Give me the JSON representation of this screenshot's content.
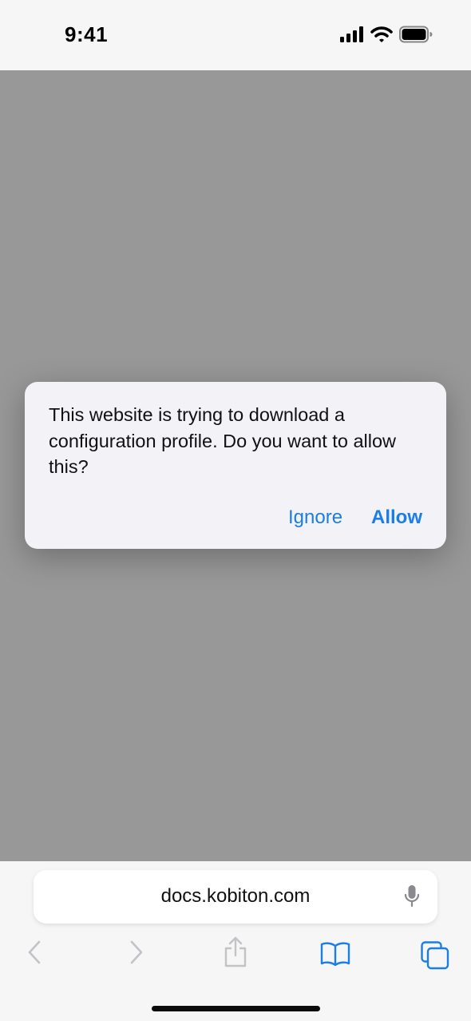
{
  "status_bar": {
    "time": "9:41",
    "icons": [
      "cellular-signal-icon",
      "wifi-icon",
      "battery-icon"
    ]
  },
  "alert": {
    "message": "This website is trying to download a configuration profile. Do you want to allow this?",
    "ignore_label": "Ignore",
    "allow_label": "Allow"
  },
  "toolbar": {
    "address": "docs.kobiton.com",
    "buttons": [
      "back-icon",
      "forward-icon",
      "share-icon",
      "bookmarks-icon",
      "tabs-icon"
    ]
  },
  "colors": {
    "accent": "#1a7ee6",
    "dim_overlay": "#989898",
    "alert_bg": "#f2f2f7",
    "bar_bg": "#f6f6f6"
  }
}
